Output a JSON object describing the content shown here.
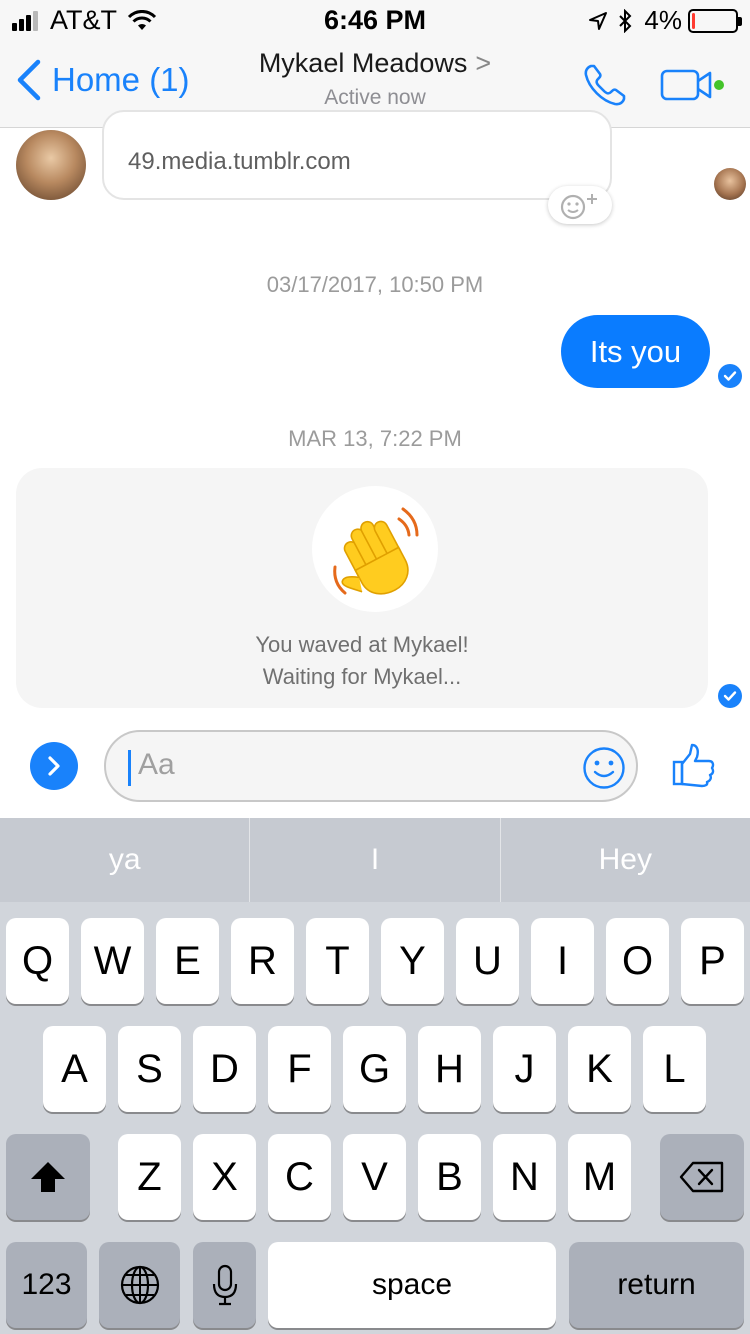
{
  "status_bar": {
    "carrier": "AT&T",
    "time": "6:46 PM",
    "battery_percent": "4%",
    "battery_level": 0.04
  },
  "nav": {
    "back_label": "Home (1)",
    "contact_name": "Mykael Meadows",
    "chevron": ">",
    "status": "Active now",
    "icons": [
      "chevron-left-icon",
      "phone-icon",
      "video-camera-icon"
    ],
    "accent_color": "#1982fb",
    "online_color": "#44c42a"
  },
  "messages": {
    "link_preview_url": "49.media.tumblr.com",
    "timestamp_1": "03/17/2017, 10:50 PM",
    "outgoing_text": "Its you",
    "outgoing_color": "#0a7cff",
    "timestamp_2": "MAR 13, 7:22 PM",
    "wave_line_1": "You waved at Mykael!",
    "wave_line_2": "Waiting for Mykael..."
  },
  "composer": {
    "placeholder": "Aa",
    "icons": [
      "chevron-right-icon",
      "smiley-icon",
      "thumbs-up-icon"
    ]
  },
  "keyboard": {
    "suggestions": [
      "ya",
      "I",
      "Hey"
    ],
    "row1": [
      "Q",
      "W",
      "E",
      "R",
      "T",
      "Y",
      "U",
      "I",
      "O",
      "P"
    ],
    "row2": [
      "A",
      "S",
      "D",
      "F",
      "G",
      "H",
      "J",
      "K",
      "L"
    ],
    "row3": [
      "Z",
      "X",
      "C",
      "V",
      "B",
      "N",
      "M"
    ],
    "numbers_label": "123",
    "space_label": "space",
    "return_label": "return"
  }
}
